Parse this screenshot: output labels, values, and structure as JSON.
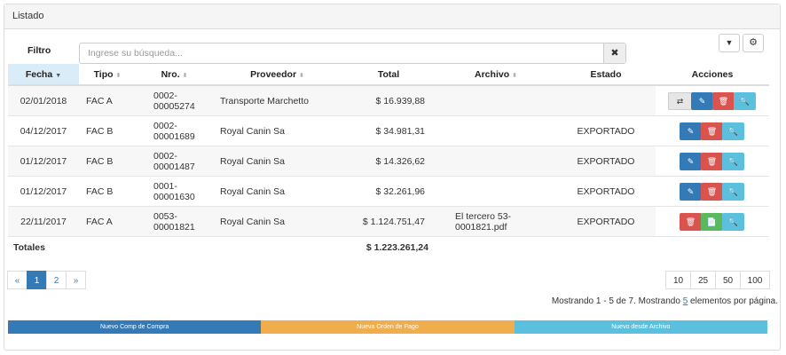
{
  "panel": {
    "title": "Listado"
  },
  "filter": {
    "label": "Filtro",
    "placeholder": "Ingrese su búsqueda...",
    "clear_icon": "✖"
  },
  "toolbar": {
    "filter_icon": "▼",
    "settings_icon": "⚙"
  },
  "table": {
    "headers": [
      "Fecha",
      "Tipo",
      "Nro.",
      "Proveedor",
      "Total",
      "Archivo",
      "Estado",
      "Acciones"
    ],
    "sort_icon": "⬍",
    "sorted_icon": "▼",
    "rows": [
      {
        "fecha": "02/01/2018",
        "tipo": "FAC A",
        "nro": "0002-00005274",
        "proveedor": "Transporte Marchetto",
        "total": "$ 16.939,88",
        "archivo": "",
        "estado": ""
      },
      {
        "fecha": "04/12/2017",
        "tipo": "FAC B",
        "nro": "0002-00001689",
        "proveedor": "Royal Canin Sa",
        "total": "$ 34.981,31",
        "archivo": "",
        "estado": "EXPORTADO"
      },
      {
        "fecha": "01/12/2017",
        "tipo": "FAC B",
        "nro": "0002-00001487",
        "proveedor": "Royal Canin Sa",
        "total": "$ 14.326,62",
        "archivo": "",
        "estado": "EXPORTADO"
      },
      {
        "fecha": "01/12/2017",
        "tipo": "FAC B",
        "nro": "0001-00001630",
        "proveedor": "Royal Canin Sa",
        "total": "$ 32.261,96",
        "archivo": "",
        "estado": "EXPORTADO"
      },
      {
        "fecha": "22/11/2017",
        "tipo": "FAC A",
        "nro": "0053-00001821",
        "proveedor": "Royal Canin Sa",
        "total": "$ 1.124.751,47",
        "archivo": "El tercero 53-0001821.pdf",
        "estado": "EXPORTADO"
      }
    ],
    "totals_label": "Totales",
    "totals_value": "$ 1.223.261,24"
  },
  "action_icons": {
    "transfer": "⇄",
    "edit": "✎",
    "delete": "🗑",
    "view": "🔍",
    "pdf": "📄"
  },
  "pagination": {
    "prev": "«",
    "pages": [
      "1",
      "2"
    ],
    "next": "»",
    "current": "1"
  },
  "page_sizes": [
    "10",
    "25",
    "50",
    "100"
  ],
  "info": {
    "prefix": "Mostrando 1 - 5 de 7. Mostrando ",
    "link": "5",
    "suffix": " elementos por página."
  },
  "bottom_actions": [
    {
      "label": "Nuevo Comp de Compra",
      "color": "#337ab7"
    },
    {
      "label": "Nueva Orden de Pago",
      "color": "#f0ad4e"
    },
    {
      "label": "Nuevo desde Archivo",
      "color": "#5bc0de"
    }
  ]
}
